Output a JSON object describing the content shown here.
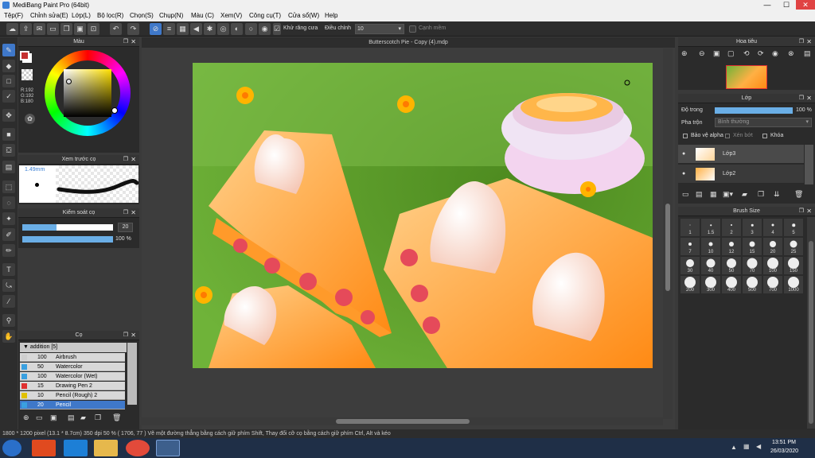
{
  "window": {
    "title": "MediBang Paint Pro (64bit)",
    "min": "—",
    "max": "☐",
    "close": "✕"
  },
  "menu": [
    "Tệp(F)",
    "Chỉnh sửa(E)",
    "Lớp(L)",
    "Bộ lọc(R)",
    "Chọn(S)",
    "Chụp(N)",
    "Màu (C)",
    "Xem(V)",
    "Công cụ(T)",
    "Cửa sổ(W)",
    "Help"
  ],
  "toolbar": {
    "antialias_label": "Khử răng cưa",
    "correction_label": "Điều chỉnh",
    "correction_value": "10",
    "snap_label": "Cạnh mềm"
  },
  "document": {
    "tab_title": "Butterscotch Pie - Copy (4).mdp"
  },
  "color_panel": {
    "title": "Màu",
    "r": "R:192",
    "g": "G:192",
    "b": "B:180",
    "fg": "#c43030",
    "bg": "#ffffff"
  },
  "brush_preview": {
    "title": "Xem trước cọ",
    "size": "1.49mm"
  },
  "brush_control": {
    "title": "Kiểm soát cọ",
    "size_value": "20",
    "opacity_value": "100 %",
    "size_fill": 0.38,
    "opacity_fill": 1.0
  },
  "brush_panel": {
    "title": "Cọ",
    "group": "addition [5]",
    "items": [
      {
        "size": "100",
        "name": "Airbrush",
        "color": "#cfcfcf"
      },
      {
        "size": "50",
        "name": "Watercolor",
        "color": "#3aa0e0"
      },
      {
        "size": "100",
        "name": "Watercolor (Wet)",
        "color": "#3aa0e0"
      },
      {
        "size": "15",
        "name": "Drawing Pen 2",
        "color": "#e03030"
      },
      {
        "size": "10",
        "name": "Pencil (Rough) 2",
        "color": "#e0c000"
      },
      {
        "size": "20",
        "name": "Pencil",
        "color": "#3aa0e0"
      }
    ]
  },
  "navigator": {
    "title": "Hoa tiêu"
  },
  "layer_panel": {
    "title": "Lớp",
    "opacity_label": "Độ trong",
    "opacity_value": "100 %",
    "opacity_fill": 1.0,
    "blend_label": "Pha trộn",
    "blend_value": "Bình thường",
    "protect_alpha": "Bảo vệ alpha",
    "clipping": "Xén bớt",
    "lock": "Khóa",
    "layers": [
      "Lớp3",
      "Lớp2"
    ]
  },
  "brush_size_panel": {
    "title": "Brush Size",
    "sizes": [
      "1",
      "1.5",
      "2",
      "3",
      "4",
      "5",
      "7",
      "10",
      "12",
      "15",
      "20",
      "25",
      "30",
      "40",
      "50",
      "70",
      "100",
      "150",
      "200",
      "300",
      "400",
      "500",
      "700",
      "1000"
    ]
  },
  "status": {
    "text": "1800 * 1200 pixel   (13.1 * 8.7cm)   350 dpi   50 %   ( 1706, 77 )   Vẽ một đường thẳng bằng cách giữ phím Shift, Thay đổi cỡ cọ bằng cách giữ phím Ctrl, Alt và kéo"
  },
  "taskbar": {
    "time": "13:51 PM",
    "date": "26/03/2020"
  }
}
